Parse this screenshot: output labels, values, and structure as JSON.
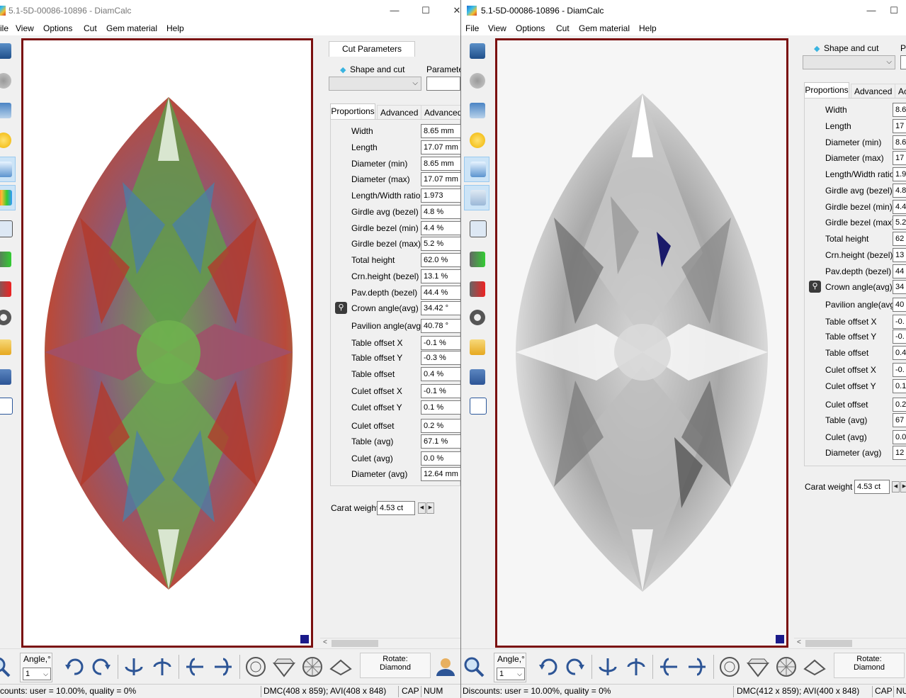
{
  "left_window": {
    "title": "5.1-5D-00086-10896 - DiamCalc",
    "window_controls": {
      "minimize": "—",
      "maximize": "☐",
      "close": "✕"
    },
    "menu": [
      "ile",
      "View",
      "Options",
      "Cut",
      "Gem material",
      "Help"
    ],
    "toolbar_icons": [
      "diamond-icon",
      "inclusion-icon",
      "paint-bucket-icon",
      "light-bulb-icon",
      "ray-trace-icon",
      "spectrum-icon",
      "photo-icon",
      "film-play-icon",
      "film-record-icon",
      "reel-icon",
      "open-folder-icon",
      "save-icon",
      "word-document-icon"
    ],
    "panel": {
      "cut_parameters_tab": "Cut Parameters",
      "shape_label": "Shape and cut",
      "parameters_label": "Parameter",
      "tabs": [
        "Proportions",
        "Advanced",
        "Advanced"
      ],
      "properties": [
        {
          "name": "Width",
          "value": "8.65 mm"
        },
        {
          "name": "Length",
          "value": "17.07 mm"
        },
        {
          "name": "Diameter (min)",
          "value": "8.65 mm"
        },
        {
          "name": "Diameter (max)",
          "value": "17.07 mm"
        },
        {
          "name": "Length/Width ratio",
          "value": "1.973"
        },
        {
          "name": "Girdle avg (bezel)",
          "value": "4.8 %"
        },
        {
          "name": "Girdle bezel (min)",
          "value": "4.4 %"
        },
        {
          "name": "Girdle bezel (max)",
          "value": "5.2 %"
        },
        {
          "name": "Total height",
          "value": "62.0 %"
        },
        {
          "name": "Crn.height (bezel)",
          "value": "13.1 %"
        },
        {
          "name": "Pav.depth (bezel)",
          "value": "44.4 %"
        },
        {
          "name": "Crown angle(avg)",
          "value": "34.42 °"
        },
        {
          "name": "Pavilion angle(avg)",
          "value": "40.78 °"
        },
        {
          "name": "Table offset X",
          "value": "-0.1 %"
        },
        {
          "name": "Table offset Y",
          "value": "-0.3 %"
        },
        {
          "name": "Table offset",
          "value": "0.4 %"
        },
        {
          "name": "Culet offset X",
          "value": "-0.1 %"
        },
        {
          "name": "Culet offset Y",
          "value": "0.1 %"
        },
        {
          "name": "Culet offset",
          "value": "0.2 %"
        },
        {
          "name": "Table (avg)",
          "value": "67.1 %"
        },
        {
          "name": "Culet (avg)",
          "value": "0.0 %"
        },
        {
          "name": "Diameter (avg)",
          "value": "12.64 mm"
        }
      ],
      "carat_label": "Carat weight",
      "carat_value": "4.53 ct"
    },
    "bottom": {
      "angle_label": "Angle,°",
      "angle_value": "1",
      "rotate_label": "Rotate:",
      "rotate_value": "Diamond"
    },
    "status": {
      "discounts": "counts: user = 10.00%, quality = 0%",
      "dmc": "DMC(408 x 859); AVI(408 x 848)",
      "cap": "CAP",
      "num": "NUM"
    }
  },
  "right_window": {
    "title": "5.1-5D-00086-10896 - DiamCalc",
    "window_controls": {
      "minimize": "—",
      "maximize": "☐"
    },
    "menu": [
      "File",
      "View",
      "Options",
      "Cut",
      "Gem material",
      "Help"
    ],
    "panel": {
      "shape_label": "Shape and cut",
      "parameters_label": "P",
      "tabs": [
        "Proportions",
        "Advanced",
        "Ac"
      ],
      "properties": [
        {
          "name": "Width",
          "value": "8.6"
        },
        {
          "name": "Length",
          "value": "17"
        },
        {
          "name": "Diameter (min)",
          "value": "8.6"
        },
        {
          "name": "Diameter (max)",
          "value": "17"
        },
        {
          "name": "Length/Width ratio",
          "value": "1.9"
        },
        {
          "name": "Girdle avg (bezel)",
          "value": "4.8"
        },
        {
          "name": "Girdle bezel (min)",
          "value": "4.4"
        },
        {
          "name": "Girdle bezel (max)",
          "value": "5.2"
        },
        {
          "name": "Total height",
          "value": "62"
        },
        {
          "name": "Crn.height (bezel)",
          "value": "13"
        },
        {
          "name": "Pav.depth (bezel)",
          "value": "44"
        },
        {
          "name": "Crown angle(avg)",
          "value": "34"
        },
        {
          "name": "Pavilion angle(avg)",
          "value": "40"
        },
        {
          "name": "Table offset X",
          "value": "-0."
        },
        {
          "name": "Table offset Y",
          "value": "-0."
        },
        {
          "name": "Table offset",
          "value": "0.4"
        },
        {
          "name": "Culet offset X",
          "value": "-0."
        },
        {
          "name": "Culet offset Y",
          "value": "0.1"
        },
        {
          "name": "Culet offset",
          "value": "0.2"
        },
        {
          "name": "Table (avg)",
          "value": "67"
        },
        {
          "name": "Culet (avg)",
          "value": "0.0"
        },
        {
          "name": "Diameter (avg)",
          "value": "12"
        }
      ],
      "carat_label": "Carat weight",
      "carat_value": "4.53 ct"
    },
    "bottom": {
      "angle_label": "Angle,°",
      "angle_value": "1",
      "rotate_label": "Rotate:",
      "rotate_value": "Diamond"
    },
    "status": {
      "discounts": "Discounts: user = 10.00%, quality = 0%",
      "dmc": "DMC(412 x 859); AVI(400 x 848)",
      "cap": "CAP",
      "num": "NU"
    }
  },
  "colors": {
    "viewport_border": "#7a1010",
    "selection": "#cce4f7",
    "accent": "#1a1a8a"
  }
}
